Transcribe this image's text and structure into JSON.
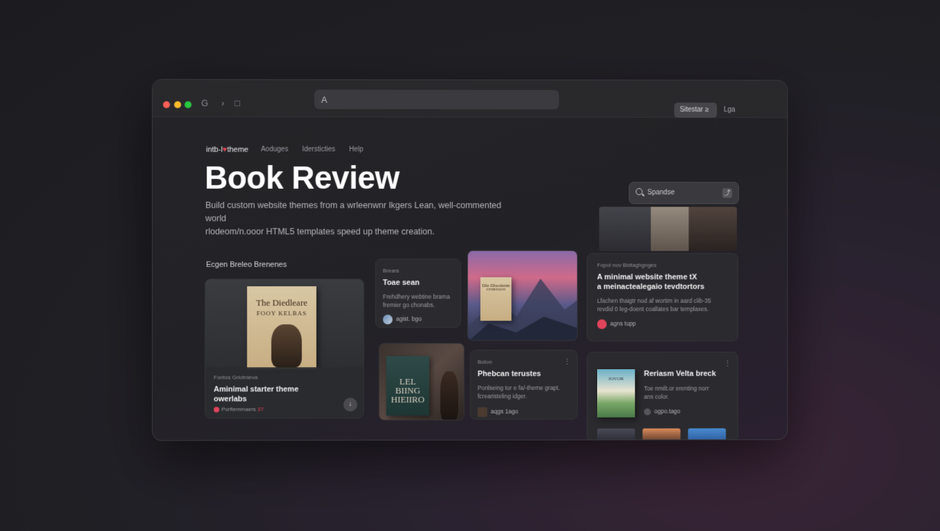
{
  "browser": {
    "url_text": "A",
    "button_label": "Sitestar ≥",
    "link_label": "Lga",
    "back_icon": "G",
    "sidebar_icon": "□"
  },
  "nav": {
    "brand": "intb-l",
    "brand_suffix": "theme",
    "items": [
      "Aoduges",
      "Idersticties",
      "Help"
    ]
  },
  "hero": {
    "title": "Book Review",
    "subtitle": "Build custom website themes from a wrleenwnr lkgers Lean, well-commented world\nrlodeom/n.ooor HTML5 templates speed up theme creation."
  },
  "search": {
    "placeholder": "Spandse",
    "go_icon": "⤴"
  },
  "section_title": "Ecgen Breleo Brenenes",
  "colors": {
    "accent": "#e0445b",
    "background": "#1f1f24",
    "card": "#2b2b2f"
  },
  "featured": {
    "book_title": "The Diedleare",
    "book_subtitle": "FOOY KELBAS",
    "kicker": "Fontos Grlotnieva",
    "title_line1": "Aminimal starter theme",
    "title_line2": "owerlabs",
    "meta_author": "Porflemmaers",
    "meta_count": "37",
    "fab_icon": "↓"
  },
  "cards": {
    "c1": {
      "kicker": "Brears",
      "title": "Toae sean",
      "desc": "Frehdhery webtine brama\nfremier go chonabs.",
      "meta": "agist. bgo"
    },
    "mountain": {
      "book_title": "Dle Dlaoderm",
      "book_sub": "ENMERSON"
    },
    "c3": {
      "kicker": "Fopol nov Bldtaghgnges",
      "title": "A minimal  website theme tX\na meinactealegaio tevdtortors",
      "desc": "Lfachen thaigtr nod af wortim in aard clib-35\nrevdid 0 leg-doent coallates bar templaxes.",
      "meta": "agns tupp"
    },
    "c4": {
      "book_title": "LEL\nBIING\nHIEIIRO"
    },
    "c5": {
      "kicker": "Boton",
      "title": "Phebcan terustes",
      "desc": "Ponlseing tor e fa/-theme grapt.\nfcrearisteling idger.",
      "meta": "aqgs 1ago"
    },
    "c6": {
      "title": "Reriasm Velta breck",
      "desc": "Toe nmilt.or erenting norr\nans color.",
      "meta": "ogpo.tago",
      "book_title": "JOVOR"
    }
  }
}
